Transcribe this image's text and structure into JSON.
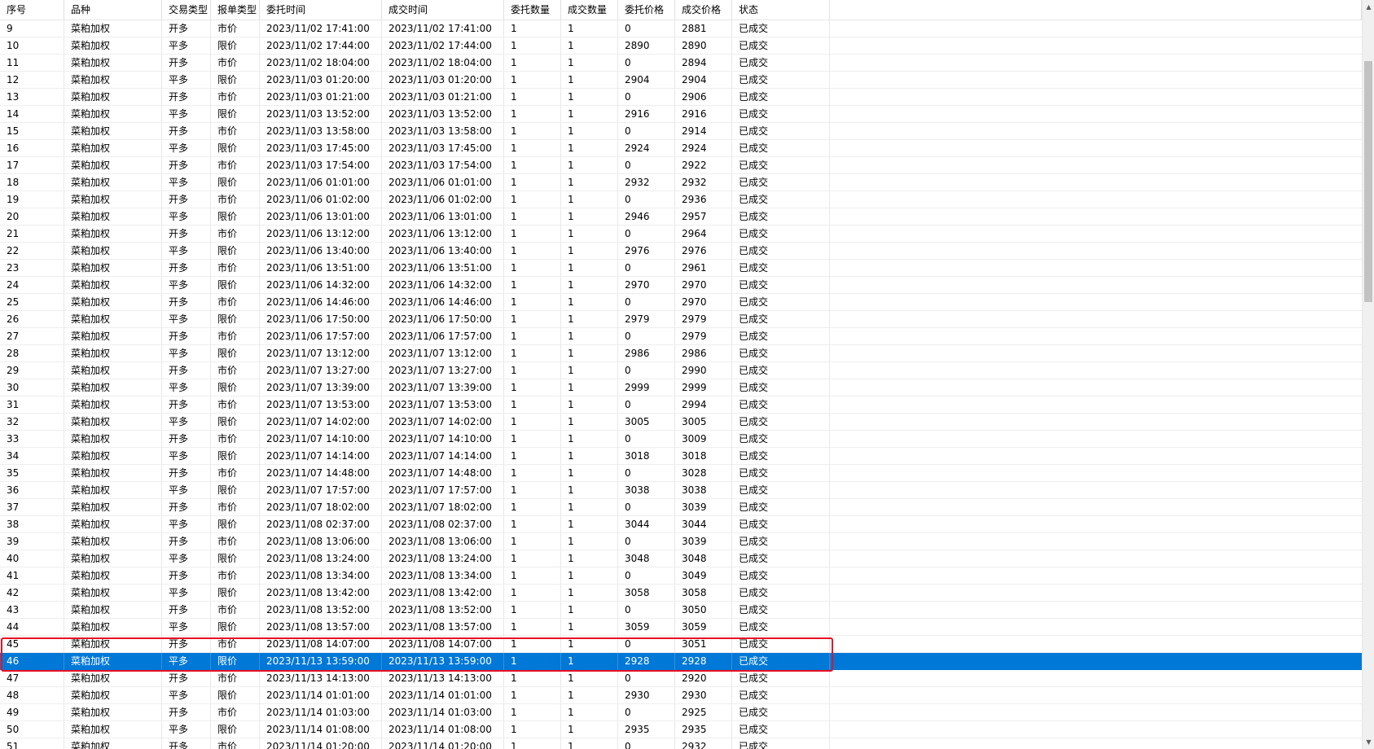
{
  "columns": [
    "序号",
    "品种",
    "交易类型",
    "报单类型",
    "委托时间",
    "成交时间",
    "委托数量",
    "成交数量",
    "委托价格",
    "成交价格",
    "状态"
  ],
  "rows": [
    [
      "9",
      "菜粕加权",
      "开多",
      "市价",
      "2023/11/02 17:41:00",
      "2023/11/02 17:41:00",
      "1",
      "1",
      "0",
      "2881",
      "已成交"
    ],
    [
      "10",
      "菜粕加权",
      "平多",
      "限价",
      "2023/11/02 17:44:00",
      "2023/11/02 17:44:00",
      "1",
      "1",
      "2890",
      "2890",
      "已成交"
    ],
    [
      "11",
      "菜粕加权",
      "开多",
      "市价",
      "2023/11/02 18:04:00",
      "2023/11/02 18:04:00",
      "1",
      "1",
      "0",
      "2894",
      "已成交"
    ],
    [
      "12",
      "菜粕加权",
      "平多",
      "限价",
      "2023/11/03 01:20:00",
      "2023/11/03 01:20:00",
      "1",
      "1",
      "2904",
      "2904",
      "已成交"
    ],
    [
      "13",
      "菜粕加权",
      "开多",
      "市价",
      "2023/11/03 01:21:00",
      "2023/11/03 01:21:00",
      "1",
      "1",
      "0",
      "2906",
      "已成交"
    ],
    [
      "14",
      "菜粕加权",
      "平多",
      "限价",
      "2023/11/03 13:52:00",
      "2023/11/03 13:52:00",
      "1",
      "1",
      "2916",
      "2916",
      "已成交"
    ],
    [
      "15",
      "菜粕加权",
      "开多",
      "市价",
      "2023/11/03 13:58:00",
      "2023/11/03 13:58:00",
      "1",
      "1",
      "0",
      "2914",
      "已成交"
    ],
    [
      "16",
      "菜粕加权",
      "平多",
      "限价",
      "2023/11/03 17:45:00",
      "2023/11/03 17:45:00",
      "1",
      "1",
      "2924",
      "2924",
      "已成交"
    ],
    [
      "17",
      "菜粕加权",
      "开多",
      "市价",
      "2023/11/03 17:54:00",
      "2023/11/03 17:54:00",
      "1",
      "1",
      "0",
      "2922",
      "已成交"
    ],
    [
      "18",
      "菜粕加权",
      "平多",
      "限价",
      "2023/11/06 01:01:00",
      "2023/11/06 01:01:00",
      "1",
      "1",
      "2932",
      "2932",
      "已成交"
    ],
    [
      "19",
      "菜粕加权",
      "开多",
      "市价",
      "2023/11/06 01:02:00",
      "2023/11/06 01:02:00",
      "1",
      "1",
      "0",
      "2936",
      "已成交"
    ],
    [
      "20",
      "菜粕加权",
      "平多",
      "限价",
      "2023/11/06 13:01:00",
      "2023/11/06 13:01:00",
      "1",
      "1",
      "2946",
      "2957",
      "已成交"
    ],
    [
      "21",
      "菜粕加权",
      "开多",
      "市价",
      "2023/11/06 13:12:00",
      "2023/11/06 13:12:00",
      "1",
      "1",
      "0",
      "2964",
      "已成交"
    ],
    [
      "22",
      "菜粕加权",
      "平多",
      "限价",
      "2023/11/06 13:40:00",
      "2023/11/06 13:40:00",
      "1",
      "1",
      "2976",
      "2976",
      "已成交"
    ],
    [
      "23",
      "菜粕加权",
      "开多",
      "市价",
      "2023/11/06 13:51:00",
      "2023/11/06 13:51:00",
      "1",
      "1",
      "0",
      "2961",
      "已成交"
    ],
    [
      "24",
      "菜粕加权",
      "平多",
      "限价",
      "2023/11/06 14:32:00",
      "2023/11/06 14:32:00",
      "1",
      "1",
      "2970",
      "2970",
      "已成交"
    ],
    [
      "25",
      "菜粕加权",
      "开多",
      "市价",
      "2023/11/06 14:46:00",
      "2023/11/06 14:46:00",
      "1",
      "1",
      "0",
      "2970",
      "已成交"
    ],
    [
      "26",
      "菜粕加权",
      "平多",
      "限价",
      "2023/11/06 17:50:00",
      "2023/11/06 17:50:00",
      "1",
      "1",
      "2979",
      "2979",
      "已成交"
    ],
    [
      "27",
      "菜粕加权",
      "开多",
      "市价",
      "2023/11/06 17:57:00",
      "2023/11/06 17:57:00",
      "1",
      "1",
      "0",
      "2979",
      "已成交"
    ],
    [
      "28",
      "菜粕加权",
      "平多",
      "限价",
      "2023/11/07 13:12:00",
      "2023/11/07 13:12:00",
      "1",
      "1",
      "2986",
      "2986",
      "已成交"
    ],
    [
      "29",
      "菜粕加权",
      "开多",
      "市价",
      "2023/11/07 13:27:00",
      "2023/11/07 13:27:00",
      "1",
      "1",
      "0",
      "2990",
      "已成交"
    ],
    [
      "30",
      "菜粕加权",
      "平多",
      "限价",
      "2023/11/07 13:39:00",
      "2023/11/07 13:39:00",
      "1",
      "1",
      "2999",
      "2999",
      "已成交"
    ],
    [
      "31",
      "菜粕加权",
      "开多",
      "市价",
      "2023/11/07 13:53:00",
      "2023/11/07 13:53:00",
      "1",
      "1",
      "0",
      "2994",
      "已成交"
    ],
    [
      "32",
      "菜粕加权",
      "平多",
      "限价",
      "2023/11/07 14:02:00",
      "2023/11/07 14:02:00",
      "1",
      "1",
      "3005",
      "3005",
      "已成交"
    ],
    [
      "33",
      "菜粕加权",
      "开多",
      "市价",
      "2023/11/07 14:10:00",
      "2023/11/07 14:10:00",
      "1",
      "1",
      "0",
      "3009",
      "已成交"
    ],
    [
      "34",
      "菜粕加权",
      "平多",
      "限价",
      "2023/11/07 14:14:00",
      "2023/11/07 14:14:00",
      "1",
      "1",
      "3018",
      "3018",
      "已成交"
    ],
    [
      "35",
      "菜粕加权",
      "开多",
      "市价",
      "2023/11/07 14:48:00",
      "2023/11/07 14:48:00",
      "1",
      "1",
      "0",
      "3028",
      "已成交"
    ],
    [
      "36",
      "菜粕加权",
      "平多",
      "限价",
      "2023/11/07 17:57:00",
      "2023/11/07 17:57:00",
      "1",
      "1",
      "3038",
      "3038",
      "已成交"
    ],
    [
      "37",
      "菜粕加权",
      "开多",
      "市价",
      "2023/11/07 18:02:00",
      "2023/11/07 18:02:00",
      "1",
      "1",
      "0",
      "3039",
      "已成交"
    ],
    [
      "38",
      "菜粕加权",
      "平多",
      "限价",
      "2023/11/08 02:37:00",
      "2023/11/08 02:37:00",
      "1",
      "1",
      "3044",
      "3044",
      "已成交"
    ],
    [
      "39",
      "菜粕加权",
      "开多",
      "市价",
      "2023/11/08 13:06:00",
      "2023/11/08 13:06:00",
      "1",
      "1",
      "0",
      "3039",
      "已成交"
    ],
    [
      "40",
      "菜粕加权",
      "平多",
      "限价",
      "2023/11/08 13:24:00",
      "2023/11/08 13:24:00",
      "1",
      "1",
      "3048",
      "3048",
      "已成交"
    ],
    [
      "41",
      "菜粕加权",
      "开多",
      "市价",
      "2023/11/08 13:34:00",
      "2023/11/08 13:34:00",
      "1",
      "1",
      "0",
      "3049",
      "已成交"
    ],
    [
      "42",
      "菜粕加权",
      "平多",
      "限价",
      "2023/11/08 13:42:00",
      "2023/11/08 13:42:00",
      "1",
      "1",
      "3058",
      "3058",
      "已成交"
    ],
    [
      "43",
      "菜粕加权",
      "开多",
      "市价",
      "2023/11/08 13:52:00",
      "2023/11/08 13:52:00",
      "1",
      "1",
      "0",
      "3050",
      "已成交"
    ],
    [
      "44",
      "菜粕加权",
      "平多",
      "限价",
      "2023/11/08 13:57:00",
      "2023/11/08 13:57:00",
      "1",
      "1",
      "3059",
      "3059",
      "已成交"
    ],
    [
      "45",
      "菜粕加权",
      "开多",
      "市价",
      "2023/11/08 14:07:00",
      "2023/11/08 14:07:00",
      "1",
      "1",
      "0",
      "3051",
      "已成交"
    ],
    [
      "46",
      "菜粕加权",
      "平多",
      "限价",
      "2023/11/13 13:59:00",
      "2023/11/13 13:59:00",
      "1",
      "1",
      "2928",
      "2928",
      "已成交"
    ],
    [
      "47",
      "菜粕加权",
      "开多",
      "市价",
      "2023/11/13 14:13:00",
      "2023/11/13 14:13:00",
      "1",
      "1",
      "0",
      "2920",
      "已成交"
    ],
    [
      "48",
      "菜粕加权",
      "平多",
      "限价",
      "2023/11/14 01:01:00",
      "2023/11/14 01:01:00",
      "1",
      "1",
      "2930",
      "2930",
      "已成交"
    ],
    [
      "49",
      "菜粕加权",
      "开多",
      "市价",
      "2023/11/14 01:03:00",
      "2023/11/14 01:03:00",
      "1",
      "1",
      "0",
      "2925",
      "已成交"
    ],
    [
      "50",
      "菜粕加权",
      "平多",
      "限价",
      "2023/11/14 01:08:00",
      "2023/11/14 01:08:00",
      "1",
      "1",
      "2935",
      "2935",
      "已成交"
    ],
    [
      "51",
      "菜粕加权",
      "开多",
      "市价",
      "2023/11/14 01:20:00",
      "2023/11/14 01:20:00",
      "1",
      "1",
      "0",
      "2932",
      "已成交"
    ]
  ],
  "selected_row_index": 37,
  "highlighted_row_indices": [
    36,
    37
  ],
  "colors": {
    "selection": "#0078d7",
    "highlight_outline": "#e81123"
  },
  "icons": {
    "scroll_up": "chevron-up-icon",
    "scroll_down": "chevron-down-icon"
  }
}
